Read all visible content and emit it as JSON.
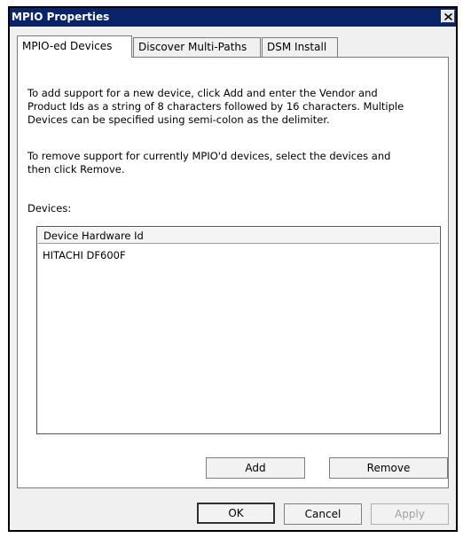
{
  "window": {
    "title": "MPIO Properties",
    "close_glyph": "✕"
  },
  "tabs": [
    {
      "label": "MPIO-ed Devices",
      "active": true
    },
    {
      "label": "Discover Multi-Paths",
      "active": false
    },
    {
      "label": "DSM Install",
      "active": false
    }
  ],
  "panel": {
    "add_instructions_lines": [
      "To add support for a new device, click Add and enter the Vendor and",
      "Product Ids as a string of 8 characters followed by 16 characters. Multiple",
      "Devices can be specified using semi-colon as the delimiter."
    ],
    "remove_instructions_lines": [
      "To remove support for currently MPIO'd devices, select the devices and",
      "then click Remove."
    ],
    "devices_label": "Devices:",
    "list": {
      "column_header": "Device Hardware Id",
      "rows": [
        "HITACHI DF600F"
      ]
    },
    "add_label": "Add",
    "remove_label": "Remove"
  },
  "footer": {
    "ok_label": "OK",
    "cancel_label": "Cancel",
    "apply_label": "Apply",
    "apply_enabled": false
  },
  "colors": {
    "titlebar": "#0a246a",
    "face": "#f0f0f0",
    "disabled_text": "#a0a0a0"
  }
}
